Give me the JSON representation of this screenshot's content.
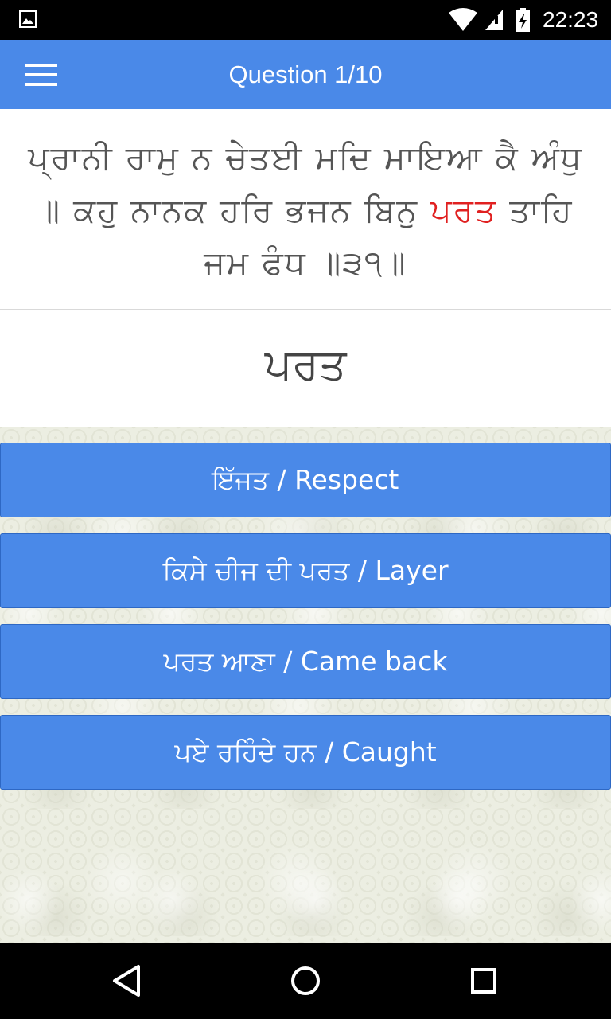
{
  "status_bar": {
    "time": "22:23",
    "icons": [
      "gallery-icon",
      "wifi-icon",
      "signal-icon",
      "battery-icon"
    ]
  },
  "app_bar": {
    "title": "Question 1/10",
    "menu_icon": "hamburger-menu-icon"
  },
  "verse": {
    "before": "ਪ੍ਰਾਨੀ ਰਾਮੁ ਨ ਚੇਤਈ ਮਦਿ ਮਾਇਆ ਕੈ ਅੰਧੁ ॥ ਕਹੁ ਨਾਨਕ ਹਰਿ ਭਜਨ ਬਿਨੁ ",
    "highlight": "ਪਰਤ",
    "after": " ਤਾਹਿ ਜਮ ਫੰਧ ॥੩੧॥",
    "highlight_color": "#e02020"
  },
  "word": "ਪਰਤ",
  "options": [
    {
      "label": "ਇੱਜਤ / Respect"
    },
    {
      "label": "ਕਿਸੇ ਚੀਜ ਦੀ ਪਰਤ / Layer"
    },
    {
      "label": "ਪਰਤ ਆਣਾ / Came back"
    },
    {
      "label": "ਪਏ ਰਹਿੰਦੇ ਹਨ / Caught"
    }
  ],
  "nav_bar": {
    "buttons": [
      "back-icon",
      "home-icon",
      "recents-icon"
    ]
  },
  "colors": {
    "accent": "#4a89e8",
    "status_bar": "#000000",
    "background": "#eeeee3"
  }
}
